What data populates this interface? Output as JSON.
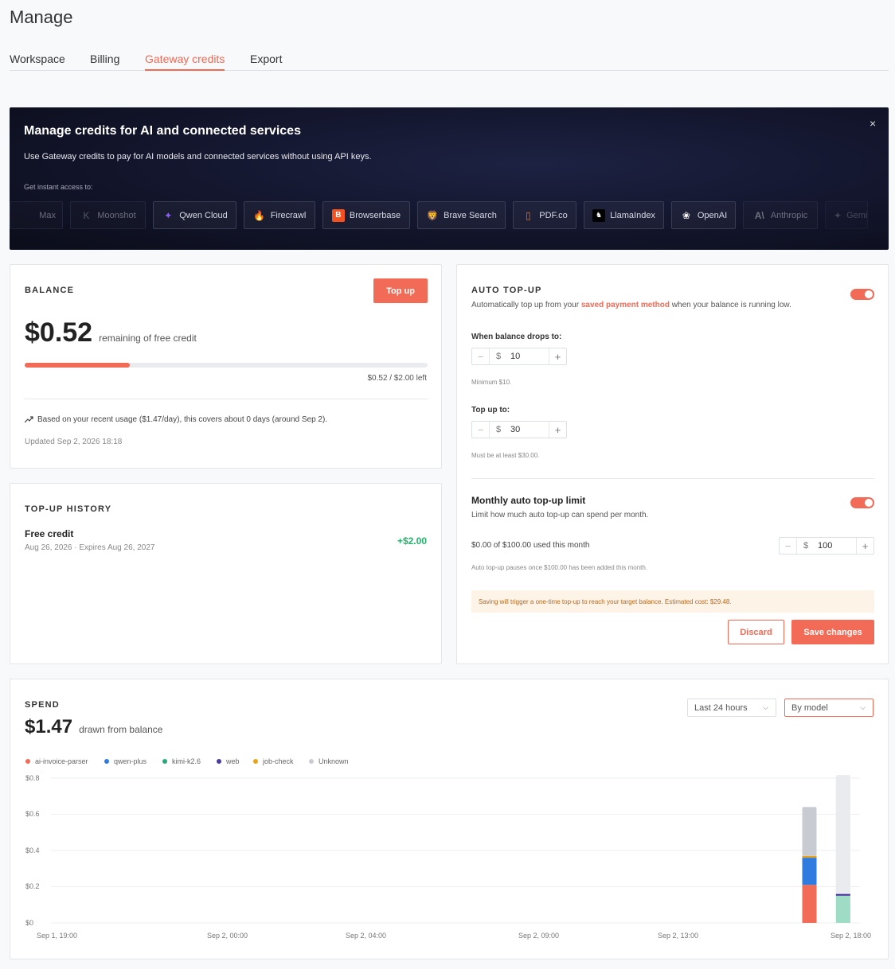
{
  "page": {
    "title": "Manage"
  },
  "tabs": [
    {
      "label": "Workspace"
    },
    {
      "label": "Billing"
    },
    {
      "label": "Gateway credits",
      "active": true
    },
    {
      "label": "Export"
    }
  ],
  "banner": {
    "title": "Manage credits for AI and connected services",
    "subtitle": "Use Gateway credits to pay for AI models and connected services without using API keys.",
    "access_label": "Get instant access to:",
    "close": "×",
    "chips": [
      {
        "label": "Max",
        "icon": "max-icon"
      },
      {
        "label": "Moonshot",
        "icon": "moonshot-icon",
        "glyph": "K"
      },
      {
        "label": "Qwen Cloud",
        "icon": "qwen-icon",
        "glyph": "✦"
      },
      {
        "label": "Firecrawl",
        "icon": "firecrawl-icon",
        "glyph": "🔥"
      },
      {
        "label": "Browserbase",
        "icon": "browserbase-icon",
        "glyph": "B"
      },
      {
        "label": "Brave Search",
        "icon": "brave-icon",
        "glyph": "🦁"
      },
      {
        "label": "PDF.co",
        "icon": "pdfco-icon",
        "glyph": "▯"
      },
      {
        "label": "LlamaIndex",
        "icon": "llamaindex-icon",
        "glyph": "♞"
      },
      {
        "label": "OpenAI",
        "icon": "openai-icon",
        "glyph": "❀"
      },
      {
        "label": "Anthropic",
        "icon": "anthropic-icon",
        "glyph": "A\\"
      },
      {
        "label": "Gemini",
        "icon": "gemini-icon",
        "glyph": "✦"
      }
    ]
  },
  "balance": {
    "eyebrow": "BALANCE",
    "topup_button": "Top up",
    "amount": "$0.52",
    "amount_suffix": "remaining of free credit",
    "progress_fraction": 0.26,
    "progress_text": "$0.52 / $2.00 left",
    "forecast": "Based on your recent usage ($1.47/day), this covers about 0 days (around Sep 2).",
    "updated": "Updated Sep 2, 2026 18:18"
  },
  "history": {
    "eyebrow": "TOP-UP HISTORY",
    "item_title": "Free credit",
    "item_meta": "Aug 26, 2026 · Expires Aug 26, 2027",
    "item_amount": "+$2.00"
  },
  "auto": {
    "eyebrow": "AUTO TOP-UP",
    "desc_pre": "Automatically top up from your",
    "desc_link": "saved payment method",
    "desc_post": "when your balance is running low.",
    "enabled": true,
    "threshold_label": "When balance drops to:",
    "threshold_currency": "$",
    "threshold_value": "10",
    "threshold_hint": "Minimum $10.",
    "target_label": "Top up to:",
    "target_currency": "$",
    "target_value": "30",
    "target_hint": "Must be at least $30.00.",
    "monthly_title": "Monthly auto top-up limit",
    "monthly_desc": "Limit how much auto top-up can spend per month.",
    "monthly_enabled": true,
    "monthly_used": "$0.00 of $100.00 used this month",
    "monthly_currency": "$",
    "monthly_value": "100",
    "monthly_hint": "Auto top-up pauses once $100.00 has been added this month.",
    "notice": "Saving will trigger a one-time top-up to reach your target balance. Estimated cost: $29.48.",
    "discard": "Discard",
    "save": "Save changes",
    "minus": "−",
    "plus": "+"
  },
  "spend": {
    "eyebrow": "SPEND",
    "amount": "$1.47",
    "amount_suffix": "drawn from balance",
    "range_select": "Last 24 hours",
    "group_select": "By model",
    "colors": {
      "ai-invoice-parser": "#f26b57",
      "qwen-plus": "#2f7be0",
      "kimi-k2.6": "#2aa877",
      "web": "#4b3aa0",
      "job-check": "#e8a317",
      "Unknown": "#c8ccd2"
    }
  },
  "chart_data": {
    "type": "bar",
    "stacked": true,
    "ylim": [
      0,
      0.8
    ],
    "yticks": [
      "$0",
      "$0.2",
      "$0.4",
      "$0.6",
      "$0.8"
    ],
    "ytick_values": [
      0,
      0.2,
      0.4,
      0.6,
      0.8
    ],
    "xticks": [
      "Sep 1, 19:00",
      "Sep 2, 00:00",
      "Sep 2, 04:00",
      "Sep 2, 09:00",
      "Sep 2, 13:00",
      "Sep 2, 18:00"
    ],
    "xtick_index": [
      0,
      5,
      9,
      14,
      18,
      23
    ],
    "bucket_count": 24,
    "legend": [
      "ai-invoice-parser",
      "qwen-plus",
      "kimi-k2.6",
      "web",
      "job-check",
      "Unknown"
    ],
    "bars": [
      {
        "bucket": 22,
        "segments": [
          {
            "series": "ai-invoice-parser",
            "value": 0.21
          },
          {
            "series": "qwen-plus",
            "value": 0.15
          },
          {
            "series": "job-check",
            "value": 0.01
          },
          {
            "series": "Unknown",
            "value": 0.27
          }
        ]
      },
      {
        "bucket": 23,
        "current": true,
        "segments": [
          {
            "series": "kimi-k2.6",
            "value": 0.15
          },
          {
            "series": "web",
            "value": 0.01
          },
          {
            "series": "Unknown",
            "value": 0.65
          }
        ]
      }
    ]
  }
}
